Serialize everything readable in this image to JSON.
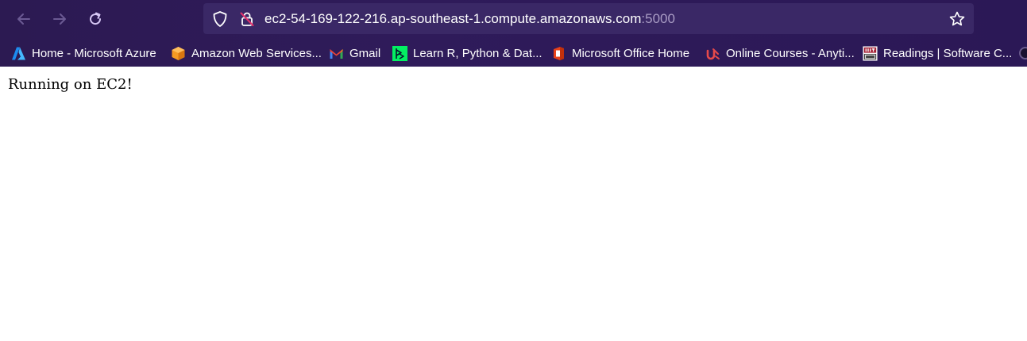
{
  "toolbar": {
    "back_icon": "arrow-left",
    "forward_icon": "arrow-right",
    "reload_icon": "reload"
  },
  "address_bar": {
    "host": "ec2-54-169-122-216.ap-southeast-1.compute.amazonaws.com",
    "port": ":5000",
    "shield_icon": "shield",
    "insecure_icon": "lock-strikethrough",
    "bookmark_icon": "star-outline"
  },
  "bookmarks": [
    {
      "label": "Home - Microsoft Azure",
      "icon": "azure-logo"
    },
    {
      "label": "Amazon Web Services...",
      "icon": "aws-cube"
    },
    {
      "label": "Gmail",
      "icon": "gmail-m"
    },
    {
      "label": "Learn R, Python & Dat...",
      "icon": "datacamp-logo"
    },
    {
      "label": "Microsoft Office Home",
      "icon": "office-logo"
    },
    {
      "label": "Online Courses - Anyti...",
      "icon": "udemy-logo"
    },
    {
      "label": "Readings | Software C...",
      "icon": "mit-ocw-logo"
    }
  ],
  "page": {
    "body_text": "Running on EC2!"
  },
  "colors": {
    "chrome_bg": "#2f1b5a",
    "url_bg": "#3a2866",
    "port_text": "#a99cc4",
    "icon_muted": "#6b5a93"
  }
}
